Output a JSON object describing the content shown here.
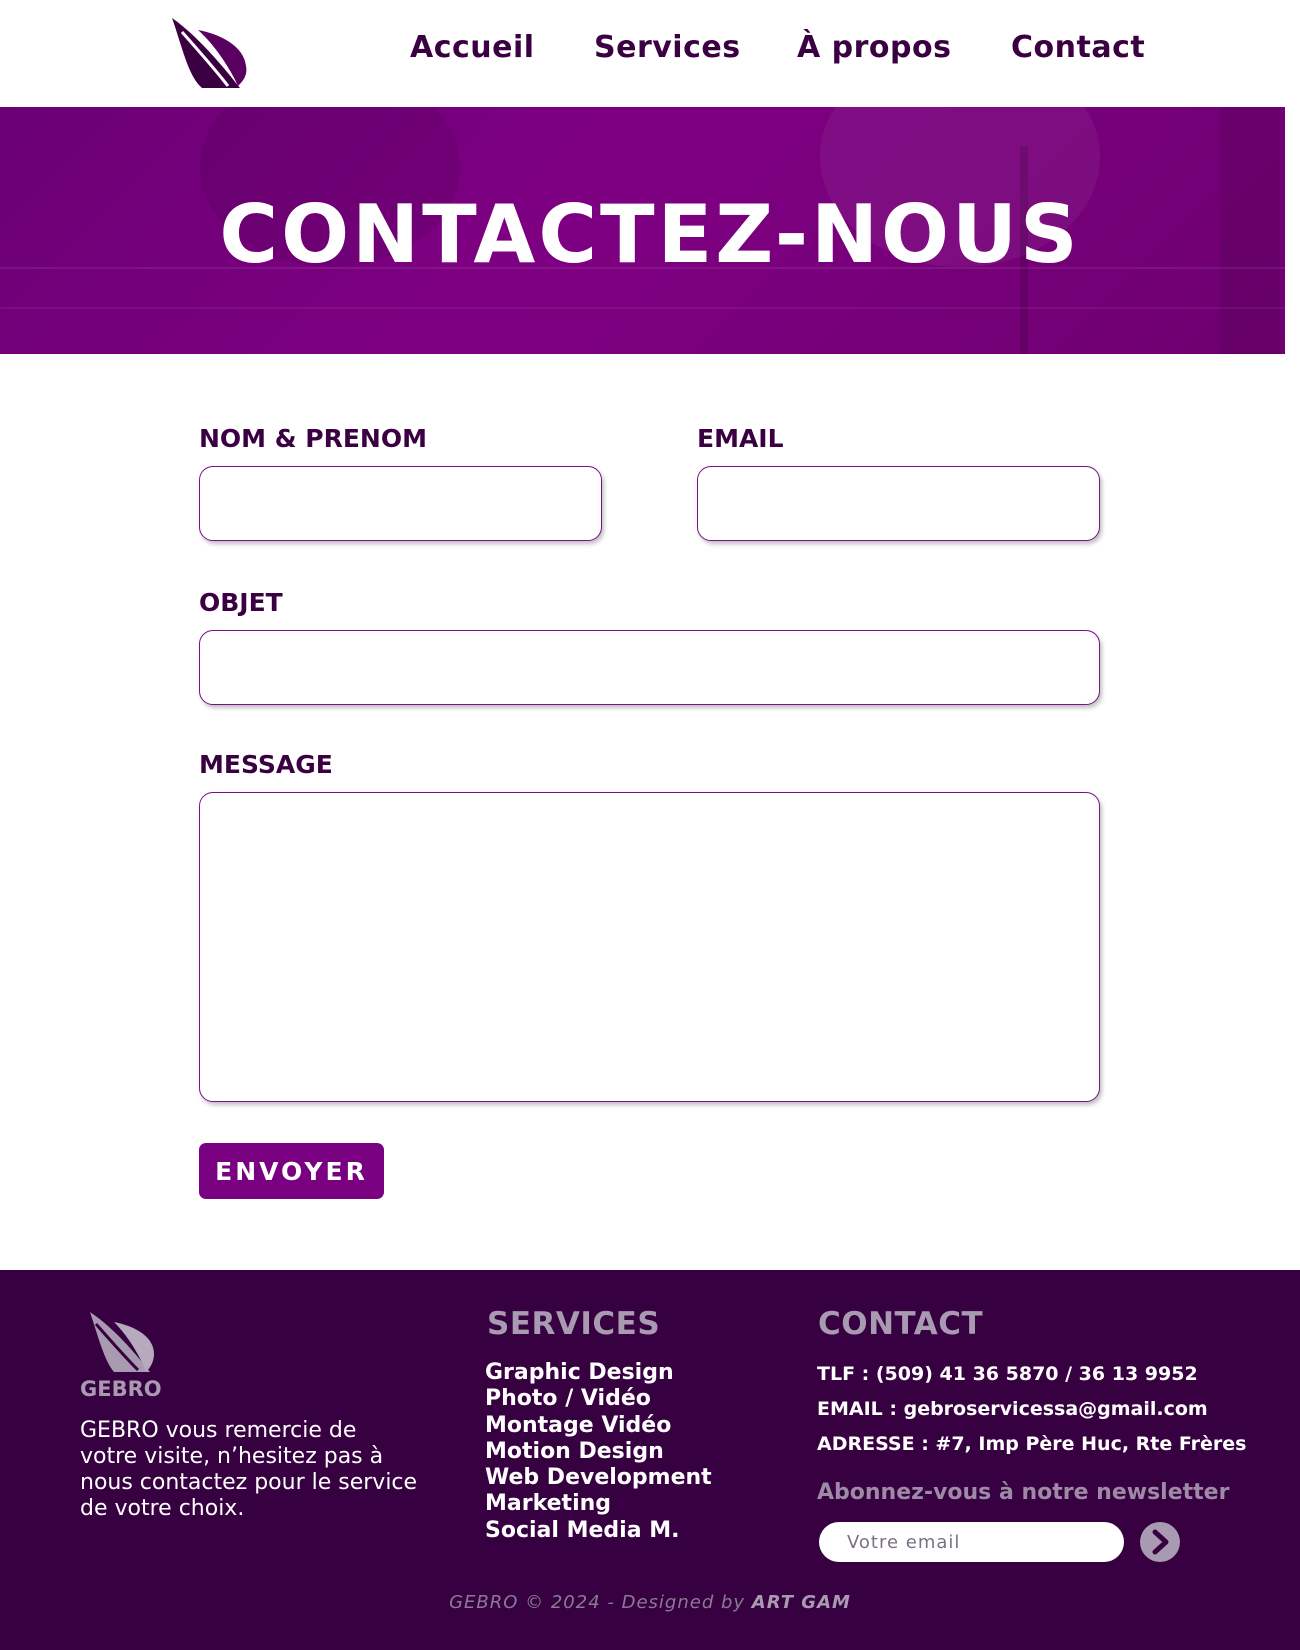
{
  "nav": {
    "items": [
      {
        "label": "Accueil"
      },
      {
        "label": "Services"
      },
      {
        "label": "À propos"
      },
      {
        "label": "Contact"
      }
    ]
  },
  "hero": {
    "title": "CONTACTEZ-NOUS"
  },
  "form": {
    "name_label": "NOM & PRENOM",
    "email_label": "EMAIL",
    "subject_label": "OBJET",
    "message_label": "MESSAGE",
    "name_value": "",
    "email_value": "",
    "subject_value": "",
    "message_value": "",
    "submit_label": "ENVOYER"
  },
  "footer": {
    "logo_text": "GEBRO",
    "description": "GEBRO vous remercie de votre visite, n’hesitez pas à nous contactez pour le service de votre choix.",
    "services_heading": "SERVICES",
    "services": [
      "Graphic Design",
      "Photo / Vidéo",
      "Montage Vidéo",
      "Motion Design",
      "Web Development",
      "Marketing",
      "Social Media M."
    ],
    "contact_heading": "CONTACT",
    "phone": "TLF : (509) 41 36 5870 / 36 13 9952",
    "email": "EMAIL : gebroservicessa@gmail.com",
    "address": "ADRESSE : #7, Imp Père Huc, Rte Frères",
    "newsletter_title": "Abonnez-vous à notre newsletter",
    "newsletter_placeholder": "Votre email",
    "copyright_prefix": "GEBRO © 2024 - Designed by ",
    "copyright_author": "ART GAM"
  },
  "colors": {
    "brand_purple": "#7a0082",
    "dark_purple": "#370040",
    "text_purple": "#3a0042",
    "muted": "#a89ab0"
  }
}
